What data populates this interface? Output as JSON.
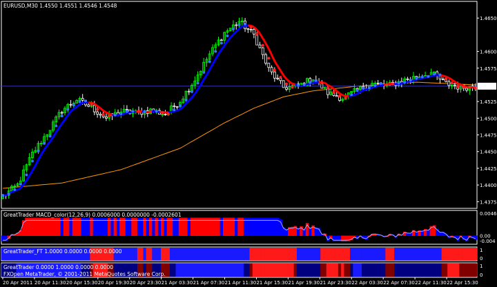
{
  "chart_data": {
    "type": "candlestick",
    "title": "EURUSD,M30  1.4550 1.4551 1.4546 1.4548",
    "symbol": "EURUSD,M30",
    "quote": [
      "1.4550",
      "1.4551",
      "1.4546",
      "1.4548"
    ],
    "current_price": "1.4548",
    "y_ticks": [
      "1.4650",
      "1.4600",
      "1.4575",
      "1.4525",
      "1.4500",
      "1.4475",
      "1.4450",
      "1.4425",
      "1.4400",
      "1.4375"
    ],
    "ylim": [
      1.4365,
      1.4675
    ],
    "x_ticks": [
      "20 Apr 2011",
      "20 Apr 11:30",
      "20 Apr 15:30",
      "20 Apr 19:30",
      "20 Apr 23:30",
      "21 Apr 03:30",
      "21 Apr 07:30",
      "21 Apr 11:30",
      "21 Apr 15:30",
      "21 Apr 19:30",
      "21 Apr 23:30",
      "22 Apr 03:30",
      "22 Apr 07:30",
      "22 Apr 11:30",
      "22 Apr 15:30"
    ],
    "close_trend": [
      [
        0,
        1.4383
      ],
      [
        5,
        1.44
      ],
      [
        10,
        1.4447
      ],
      [
        15,
        1.4478
      ],
      [
        20,
        1.4512
      ],
      [
        25,
        1.4528
      ],
      [
        30,
        1.4516
      ],
      [
        35,
        1.45
      ],
      [
        40,
        1.451
      ],
      [
        45,
        1.4508
      ],
      [
        50,
        1.4512
      ],
      [
        55,
        1.4506
      ],
      [
        60,
        1.4526
      ],
      [
        65,
        1.4558
      ],
      [
        70,
        1.4596
      ],
      [
        75,
        1.4628
      ],
      [
        80,
        1.4645
      ],
      [
        85,
        1.4625
      ],
      [
        90,
        1.4573
      ],
      [
        95,
        1.4546
      ],
      [
        100,
        1.4548
      ],
      [
        105,
        1.456
      ],
      [
        110,
        1.4538
      ],
      [
        115,
        1.453
      ],
      [
        120,
        1.4542
      ],
      [
        125,
        1.4552
      ],
      [
        130,
        1.4548
      ],
      [
        135,
        1.4556
      ],
      [
        140,
        1.4562
      ],
      [
        145,
        1.4568
      ],
      [
        150,
        1.4552
      ],
      [
        155,
        1.4546
      ],
      [
        160,
        1.4548
      ]
    ],
    "slow_ma": [
      [
        0,
        1.4395
      ],
      [
        20,
        1.4403
      ],
      [
        40,
        1.4423
      ],
      [
        60,
        1.4455
      ],
      [
        75,
        1.4493
      ],
      [
        85,
        1.4515
      ],
      [
        95,
        1.4532
      ],
      [
        105,
        1.4541
      ],
      [
        120,
        1.4548
      ],
      [
        140,
        1.4554
      ],
      [
        160,
        1.455
      ]
    ],
    "macd_panel": {
      "label": "GreatTrader MACD_color(12,26,9) 0.0006000 0.0000000 -0.0002601",
      "y_ticks": [
        "0.004695",
        "0.00",
        "-0.004"
      ]
    },
    "ft_panel": {
      "label": "GreatTrader_FT 1.0000 0.0000 0.0000 0.0000",
      "y_ticks": [
        "1",
        "0"
      ],
      "states": [
        "down",
        "up",
        "down",
        "up",
        "down",
        "up",
        "down",
        "up",
        "down",
        "up",
        "down",
        "up",
        "down",
        "up",
        "down"
      ]
    },
    "gt_panel": {
      "label": "GreatTrader 0.0000 1.0000 0.0000 0.0000",
      "y_ticks": [
        "1",
        "0"
      ]
    },
    "copyright": "FXOpen MetaTrader, © 2001-2011 MetaQuotes Software Corp.",
    "colors": {
      "background": "#000000",
      "bull": "#00ff00",
      "bear": "#ffffff",
      "fast_band": "#0000ff",
      "slow_band": "#ff0000",
      "slow_ma": "#ff9900",
      "dots_up": "#3377ff",
      "dots_down": "#ff2020",
      "price_line": "#3333cc",
      "macd_up": "#ff0000",
      "macd_down": "#0000ff",
      "signal": "#aaaaff"
    }
  }
}
